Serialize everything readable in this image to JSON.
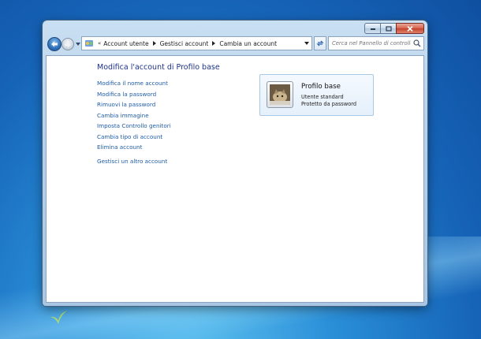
{
  "window": {
    "minimize_icon": "minimize-icon",
    "maximize_icon": "maximize-icon",
    "close_icon": "close-icon"
  },
  "navigation": {
    "back_icon": "back-arrow-icon",
    "forward_icon": "forward-arrow-icon",
    "address_icon": "control-panel-icon",
    "chevron": "«",
    "breadcrumbs": [
      {
        "label": "Account utente"
      },
      {
        "label": "Gestisci account"
      },
      {
        "label": "Cambia un account"
      }
    ],
    "refresh_icon": "refresh-icon",
    "search": {
      "placeholder": "Cerca nel Pannello di controllo",
      "value": "",
      "icon": "search-icon"
    }
  },
  "main": {
    "title": "Modifica l'account di Profilo base",
    "tasks": [
      {
        "label": "Modifica il nome account"
      },
      {
        "label": "Modifica la password"
      },
      {
        "label": "Rimuovi la password"
      },
      {
        "label": "Cambia immagine"
      },
      {
        "label": "Imposta Controllo genitori"
      },
      {
        "label": "Cambia tipo di account"
      },
      {
        "label": "Elimina account"
      }
    ],
    "other_task": {
      "label": "Gestisci un altro account"
    }
  },
  "account_card": {
    "name": "Profilo base",
    "type": "Utente standard",
    "status": "Protetto da password"
  },
  "colors": {
    "link": "#1e5ca8",
    "title": "#1e3287",
    "close_button": "#c2412b"
  }
}
